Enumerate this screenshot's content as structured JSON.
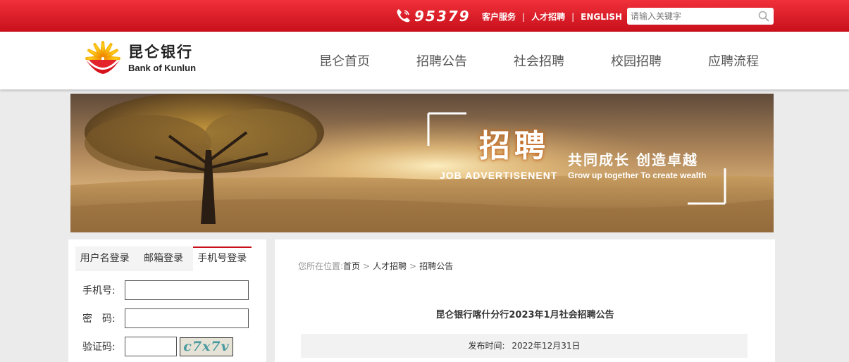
{
  "topbar": {
    "hotline": "95379",
    "links": [
      "客户服务",
      "人才招聘",
      "ENGLISH"
    ],
    "separator": "|",
    "search_placeholder": "请输入关键字",
    "color": "#d2121c"
  },
  "header": {
    "logo_cn": "昆仑银行",
    "logo_en": "Bank of Kunlun",
    "nav": [
      "昆仑首页",
      "招聘公告",
      "社会招聘",
      "校园招聘",
      "应聘流程"
    ]
  },
  "banner": {
    "title": "招聘",
    "subtitle_cn": "共同成长  创造卓越",
    "subtitle_en_left": "JOB  ADVERTISENENT",
    "subtitle_en_right": "Grow up together To create wealth"
  },
  "login": {
    "tabs": [
      "用户名登录",
      "邮箱登录",
      "手机号登录"
    ],
    "active_tab": "手机号登录",
    "fields": {
      "phone_label": "手机号:",
      "password_label": "密　码:",
      "captcha_label": "验证码:"
    },
    "captcha_text": "c7x7v"
  },
  "content": {
    "breadcrumb_prefix": "您所在位置:",
    "breadcrumb": [
      "首页",
      "人才招聘",
      "招聘公告"
    ],
    "breadcrumb_sep": ">",
    "title": "昆仑银行喀什分行2023年1月社会招聘公告",
    "publish_label": "发布时间:",
    "publish_date": "2022年12月31日"
  }
}
